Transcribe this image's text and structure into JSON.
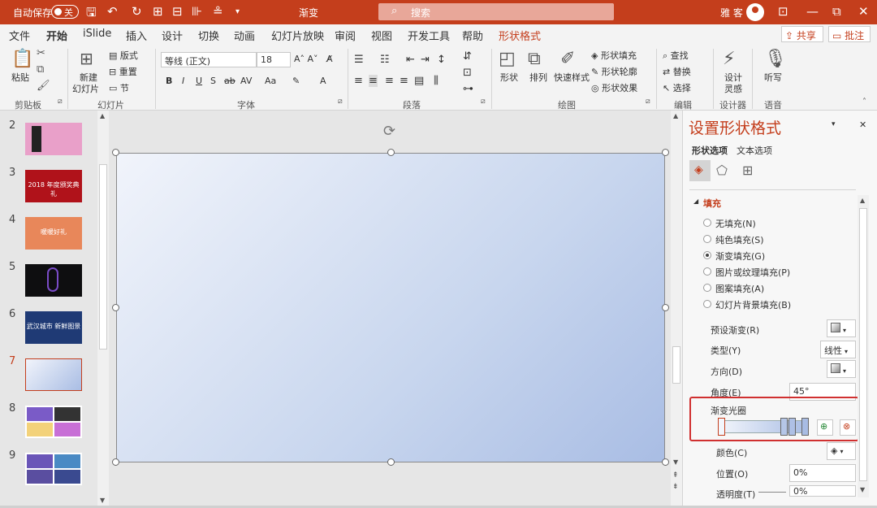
{
  "titlebar": {
    "autosave": "自动保存",
    "toggle": "关",
    "title": "渐变",
    "search": "搜索",
    "user": "雅 客"
  },
  "tabs": [
    "文件",
    "开始",
    "iSlide",
    "插入",
    "设计",
    "切换",
    "动画",
    "幻灯片放映",
    "审阅",
    "视图",
    "开发工具",
    "帮助",
    "形状格式"
  ],
  "share": "共享",
  "comments": "批注",
  "ribbon": {
    "paste": "粘贴",
    "new_slide_1": "新建",
    "new_slide_2": "幻灯片",
    "layout": "版式",
    "reset": "重置",
    "section": "节",
    "font_name": "等线 (正文)",
    "font_size": "18",
    "shape": "形状",
    "arrange": "排列",
    "quick_styles": "快速样式",
    "shape_fill": "形状填充",
    "shape_outline": "形状轮廓",
    "shape_effects": "形状效果",
    "find": "查找",
    "replace": "替换",
    "select": "选择",
    "designer_1": "设计",
    "designer_2": "灵感",
    "dictate": "听写",
    "groups": {
      "clipboard": "剪贴板",
      "slides": "幻灯片",
      "font": "字体",
      "paragraph": "段落",
      "drawing": "绘图",
      "editing": "编辑",
      "designer": "设计器",
      "voice": "语音"
    }
  },
  "thumbnails": [
    {
      "num": "2",
      "text": "",
      "color": "#e9a0c9"
    },
    {
      "num": "3",
      "text": "2018 年度颁奖典礼",
      "color": "#b0121a"
    },
    {
      "num": "4",
      "text": "暖暖好礼",
      "color": "#e8875a"
    },
    {
      "num": "5",
      "text": "",
      "color": "#0e0e10"
    },
    {
      "num": "6",
      "text": "武汉城市 新鲜图景",
      "color": "#1f3a75"
    },
    {
      "num": "7",
      "text": "",
      "color": "#c9d6ee"
    },
    {
      "num": "8",
      "text": "",
      "color": "#f0f0f0"
    },
    {
      "num": "9",
      "text": "",
      "color": "#3f62a8"
    }
  ],
  "pane": {
    "title": "设置形状格式",
    "tab_shape": "形状选项",
    "tab_text": "文本选项",
    "fill_header": "填充",
    "fill_options": [
      "无填充(N)",
      "纯色填充(S)",
      "渐变填充(G)",
      "图片或纹理填充(P)",
      "图案填充(A)",
      "幻灯片背景填充(B)"
    ],
    "selected_index": 2,
    "preset_label": "预设渐变(R)",
    "type_label": "类型(Y)",
    "type_value": "线性",
    "direction_label": "方向(D)",
    "angle_label": "角度(E)",
    "angle_value": "45°",
    "stops_label": "渐变光圈",
    "color_label": "颜色(C)",
    "position_label": "位置(O)",
    "position_value": "0%",
    "transparency_label": "透明度(T)",
    "transparency_value": "0%"
  },
  "colors": {
    "accent": "#c43e1c",
    "highlight_box": "#d03030"
  }
}
